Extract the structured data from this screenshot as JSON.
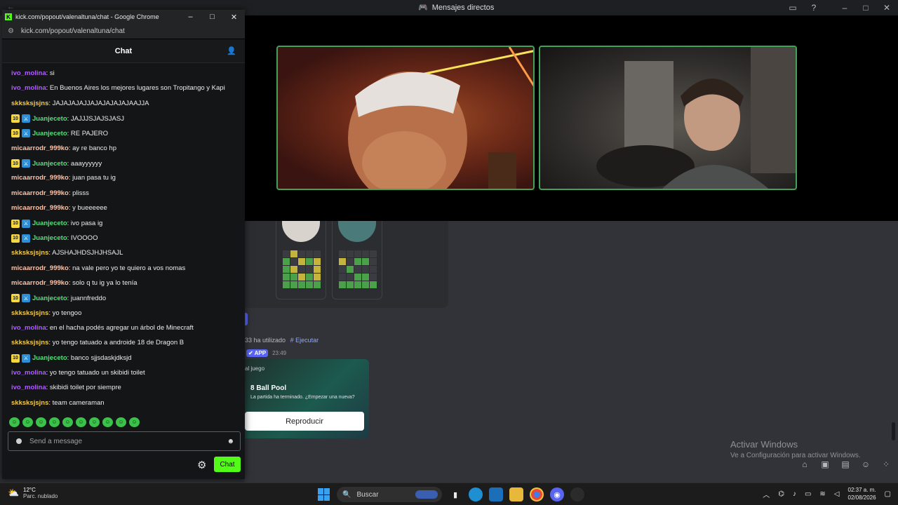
{
  "discord": {
    "window_title": "Mensajes directos",
    "used_text": "33  ha utilizado",
    "command": "# Ejecutar",
    "app_badge": "✔ APP",
    "time": "23:49",
    "game_label": "al juego",
    "game_title": "8 Ball Pool",
    "game_subtitle": "La partida ha terminado. ¿Empezar una nueva?",
    "play_button": "Reproducir",
    "activate_title": "Activar Windows",
    "activate_sub": "Ve a Configuración para activar Windows."
  },
  "chrome": {
    "title": "kick.com/popout/valenaltuna/chat - Google Chrome",
    "url": "kick.com/popout/valenaltuna/chat"
  },
  "chat": {
    "header": "Chat",
    "messages": [
      {
        "user": "ivo_molina",
        "text": ": si"
      },
      {
        "user": "ivo_molina",
        "text": ": En Buenos Aires los mejores lugares son Tropitango y Kapi"
      },
      {
        "user": "skksksjsjns",
        "text": ": JAJAJAJAJJAJAJAJAJAJAAJJA"
      },
      {
        "user": "Juanjeceto",
        "text": ": JAJJJSJAJSJASJ"
      },
      {
        "user": "Juanjeceto",
        "text": ": RE PAJERO"
      },
      {
        "user": "micaarrodr_999ko",
        "text": ": ay re banco hp"
      },
      {
        "user": "Juanjeceto",
        "text": ": aaayyyyyy"
      },
      {
        "user": "micaarrodr_999ko",
        "text": ": juan pasa tu ig"
      },
      {
        "user": "micaarrodr_999ko",
        "text": ": plisss"
      },
      {
        "user": "micaarrodr_999ko",
        "text": ": y bueeeeee"
      },
      {
        "user": "Juanjeceto",
        "text": ": ivo pasa ig"
      },
      {
        "user": "Juanjeceto",
        "text": ": IVOOOO"
      },
      {
        "user": "skksksjsjns",
        "text": ": AJSHAJHDSJHJHSAJL"
      },
      {
        "user": "micaarrodr_999ko",
        "text": ": na vale pero yo te quiero a vos nomas"
      },
      {
        "user": "micaarrodr_999ko",
        "text": ": solo q tu ig ya lo tenía"
      },
      {
        "user": "Juanjeceto",
        "text": ": juannfreddo"
      },
      {
        "user": "skksksjsjns",
        "text": ": yo tengoo"
      },
      {
        "user": "ivo_molina",
        "text": ": en el hacha podés agregar un árbol de Minecraft"
      },
      {
        "user": "skksksjsjns",
        "text": ": yo tengo tatuado a androide 18 de Dragon B"
      },
      {
        "user": "Juanjeceto",
        "text": ": banco sjjsdaskjdksjd"
      },
      {
        "user": "ivo_molina",
        "text": ": yo tengo tatuado un skibidi toilet"
      },
      {
        "user": "ivo_molina",
        "text": ": skibidi toilet por siempre"
      },
      {
        "user": "skksksjsjns",
        "text": ": team cameraman"
      }
    ],
    "badge_level": "10",
    "input_placeholder": "Send a message",
    "send_label": "Chat"
  },
  "user_colors": {
    "ivo_molina": "#b05cff",
    "skksksjsjns": "#f2c94c",
    "Juanjeceto": "#53e07a",
    "micaarrodr_999ko": "#ffc2a8"
  },
  "taskbar": {
    "weather_temp": "12°C",
    "weather_desc": "Parc. nublado",
    "search_label": "Buscar",
    "time": "02:37 a. m.",
    "date": "02/08/2026"
  }
}
